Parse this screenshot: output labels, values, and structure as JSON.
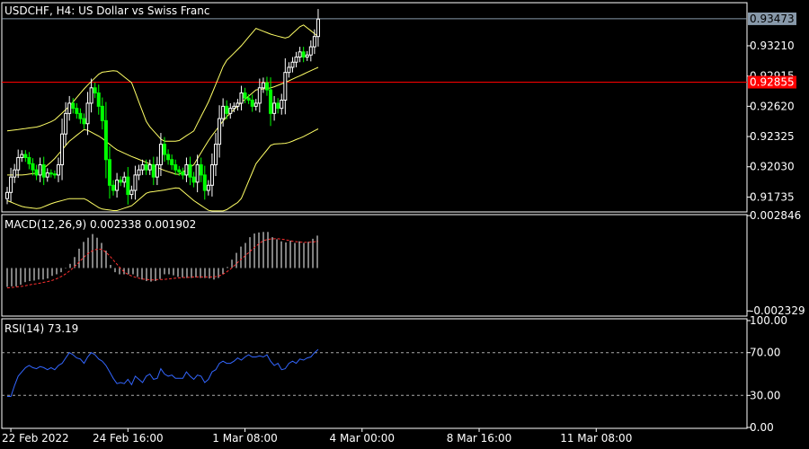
{
  "chart_data": [
    {
      "type": "candlestick",
      "title": "USDCHF, H4:  US Dollar vs Swiss Franc",
      "symbol": "USDCHF",
      "timeframe": "H4",
      "ylim": [
        0.9159,
        0.9363
      ],
      "y_ticks": [
        "0.93210",
        "0.92915",
        "0.92620",
        "0.92325",
        "0.92030",
        "0.91735"
      ],
      "current_price_label": "0.93473",
      "current_price": 0.93473,
      "horizontal_line": {
        "label": "0.92855",
        "value": 0.92855,
        "color": "#ff0000"
      },
      "x_labels": [
        "22 Feb 2022",
        "24 Feb 16:00",
        "1 Mar 08:00",
        "4 Mar 00:00",
        "8 Mar 16:00",
        "11 Mar 08:00"
      ],
      "x_label_bar_index": [
        1,
        33,
        65,
        97,
        129,
        161
      ],
      "bullish_color": "#ffffff",
      "bearish_color": "#00ff00",
      "bollinger_color": "#ffff66",
      "closes": [
        0.9178,
        0.9193,
        0.92,
        0.9212,
        0.9215,
        0.9212,
        0.9206,
        0.92,
        0.9195,
        0.9205,
        0.9193,
        0.9197,
        0.9196,
        0.9195,
        0.9205,
        0.9235,
        0.9255,
        0.9265,
        0.926,
        0.9255,
        0.925,
        0.9245,
        0.9265,
        0.928,
        0.9275,
        0.9262,
        0.9248,
        0.921,
        0.9185,
        0.918,
        0.919,
        0.9188,
        0.9193,
        0.9176,
        0.918,
        0.9195,
        0.92,
        0.9205,
        0.92,
        0.9205,
        0.9193,
        0.9205,
        0.9225,
        0.9215,
        0.921,
        0.9205,
        0.92,
        0.9198,
        0.9195,
        0.9205,
        0.9193,
        0.9188,
        0.9205,
        0.9195,
        0.918,
        0.9185,
        0.9205,
        0.9225,
        0.925,
        0.9262,
        0.9255,
        0.926,
        0.9262,
        0.9265,
        0.9275,
        0.927,
        0.9268,
        0.9262,
        0.9265,
        0.928,
        0.9285,
        0.9278,
        0.9255,
        0.9265,
        0.926,
        0.9268,
        0.9295,
        0.93,
        0.9305,
        0.931,
        0.9315,
        0.931,
        0.9312,
        0.932,
        0.933,
        0.9347
      ],
      "bollinger": {
        "upper": [
          0.9238,
          0.924,
          0.9242,
          0.9248,
          0.9262,
          0.928,
          0.9295,
          0.9297,
          0.9285,
          0.9245,
          0.9228,
          0.9228,
          0.9238,
          0.9268,
          0.9305,
          0.932,
          0.9338,
          0.9332,
          0.9328,
          0.9342,
          0.933
        ],
        "middle": [
          0.9195,
          0.9195,
          0.9197,
          0.921,
          0.9228,
          0.924,
          0.9232,
          0.922,
          0.9213,
          0.9207,
          0.92,
          0.9195,
          0.9205,
          0.923,
          0.925,
          0.9265,
          0.9278,
          0.928,
          0.9286,
          0.9293,
          0.93
        ],
        "lower": [
          0.917,
          0.9164,
          0.9162,
          0.9168,
          0.9172,
          0.9172,
          0.9162,
          0.916,
          0.9165,
          0.9178,
          0.918,
          0.9183,
          0.917,
          0.916,
          0.916,
          0.917,
          0.9206,
          0.9225,
          0.9226,
          0.9232,
          0.924
        ]
      }
    },
    {
      "type": "histogram",
      "title": "MACD(12,26,9) 0.002338 0.001902",
      "indicator": "MACD",
      "params": [
        12,
        26,
        9
      ],
      "macd_value": 0.002338,
      "signal_value": 0.001902,
      "ylim": [
        -0.00261,
        0.0029
      ],
      "y_ticks": [
        "0.002846",
        "-0.002329"
      ],
      "histogram_color": "#ffffff",
      "signal_color": "#ff3030",
      "macd_pct": [
        -0.36,
        -0.35,
        -0.35,
        -0.32,
        -0.27,
        -0.25,
        -0.24,
        -0.22,
        -0.22,
        -0.2,
        -0.15,
        -0.12,
        -0.08,
        -0.01,
        0.08,
        0.21,
        0.37,
        0.5,
        0.58,
        0.65,
        0.58,
        0.48,
        0.33,
        0.06,
        -0.08,
        -0.12,
        -0.12,
        -0.12,
        -0.12,
        -0.17,
        -0.22,
        -0.25,
        -0.26,
        -0.25,
        -0.21,
        -0.12,
        -0.12,
        -0.14,
        -0.17,
        -0.18,
        -0.19,
        -0.19,
        -0.18,
        -0.19,
        -0.19,
        -0.2,
        -0.22,
        -0.19,
        -0.12,
        0.02,
        0.16,
        0.29,
        0.41,
        0.48,
        0.59,
        0.66,
        0.68,
        0.69,
        0.69,
        0.59,
        0.55,
        0.51,
        0.49,
        0.52,
        0.48,
        0.51,
        0.48,
        0.5,
        0.56,
        0.62
      ],
      "signal_pct": [
        -0.38,
        -0.37,
        -0.36,
        -0.35,
        -0.33,
        -0.31,
        -0.3,
        -0.28,
        -0.26,
        -0.24,
        -0.2,
        -0.15,
        -0.09,
        -0.01,
        0.08,
        0.18,
        0.27,
        0.33,
        0.37,
        0.35,
        0.28,
        0.17,
        0.06,
        -0.05,
        -0.12,
        -0.16,
        -0.19,
        -0.21,
        -0.22,
        -0.23,
        -0.22,
        -0.22,
        -0.21,
        -0.2,
        -0.19,
        -0.18,
        -0.18,
        -0.17,
        -0.17,
        -0.17,
        -0.17,
        -0.17,
        -0.16,
        -0.12,
        -0.06,
        0.02,
        0.11,
        0.2,
        0.28,
        0.37,
        0.45,
        0.52,
        0.55,
        0.56,
        0.56,
        0.55,
        0.53,
        0.51,
        0.5,
        0.49,
        0.49,
        0.5,
        0.51
      ]
    },
    {
      "type": "line",
      "title": "RSI(14) 73.19",
      "indicator": "RSI",
      "period": 14,
      "value": 73.19,
      "ylim": [
        0,
        100
      ],
      "y_ticks": [
        "100.00",
        "70.00",
        "30.00",
        "0.00"
      ],
      "levels": [
        70,
        30
      ],
      "line_color": "#3366ff",
      "values": [
        29,
        29,
        39,
        48,
        52,
        56,
        58,
        56,
        55,
        57,
        56,
        54,
        56,
        54,
        58,
        60,
        65,
        70,
        68,
        65,
        64,
        60,
        66,
        70,
        68,
        64,
        62,
        58,
        52,
        46,
        41,
        42,
        41,
        45,
        40,
        48,
        45,
        42,
        48,
        50,
        45,
        46,
        55,
        50,
        48,
        49,
        46,
        46,
        46,
        52,
        48,
        45,
        49,
        48,
        42,
        45,
        52,
        54,
        60,
        62,
        60,
        60,
        62,
        65,
        63,
        66,
        68,
        66,
        66,
        67,
        66,
        68,
        62,
        58,
        60,
        54,
        55,
        60,
        62,
        60,
        64,
        63,
        65,
        66,
        70,
        73
      ]
    }
  ]
}
